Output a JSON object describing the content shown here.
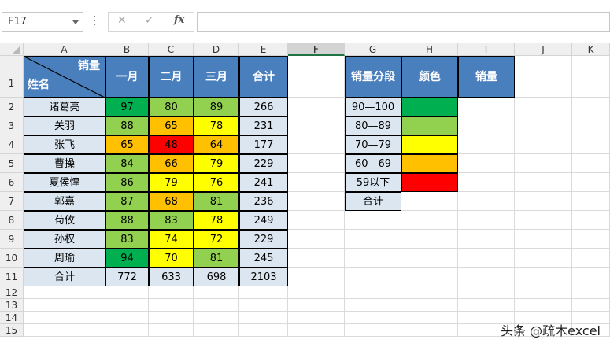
{
  "formula_bar": {
    "name_box": "F17",
    "cancel_icon": "✕",
    "enter_icon": "✓",
    "fx_label": "fx",
    "formula": ""
  },
  "columns": [
    "A",
    "B",
    "C",
    "D",
    "E",
    "F",
    "G",
    "H",
    "I",
    "J",
    "K"
  ],
  "selected_column": "F",
  "rows": [
    "1",
    "2",
    "3",
    "4",
    "5",
    "6",
    "7",
    "8",
    "9",
    "10",
    "11",
    "12",
    "13",
    "14",
    "15"
  ],
  "table": {
    "header_top_right": "销量",
    "header_bottom_left": "姓名",
    "month_headers": [
      "一月",
      "二月",
      "三月",
      "合计"
    ],
    "data": [
      {
        "name": "诸葛亮",
        "b": "97",
        "c": "80",
        "d": "89",
        "e": "266"
      },
      {
        "name": "关羽",
        "b": "88",
        "c": "65",
        "d": "78",
        "e": "231"
      },
      {
        "name": "张飞",
        "b": "65",
        "c": "48",
        "d": "64",
        "e": "177"
      },
      {
        "name": "曹操",
        "b": "84",
        "c": "66",
        "d": "79",
        "e": "229"
      },
      {
        "name": "夏侯惇",
        "b": "86",
        "c": "79",
        "d": "76",
        "e": "241"
      },
      {
        "name": "郭嘉",
        "b": "87",
        "c": "68",
        "d": "81",
        "e": "236"
      },
      {
        "name": "荀攸",
        "b": "88",
        "c": "83",
        "d": "78",
        "e": "249"
      },
      {
        "name": "孙权",
        "b": "83",
        "c": "74",
        "d": "72",
        "e": "229"
      },
      {
        "name": "周瑜",
        "b": "94",
        "c": "70",
        "d": "81",
        "e": "245"
      }
    ],
    "total": {
      "name": "合计",
      "b": "772",
      "c": "633",
      "d": "698",
      "e": "2103"
    }
  },
  "legend_table": {
    "headers": [
      "销量分段",
      "颜色",
      "销量"
    ],
    "rows": [
      "90—100",
      "80—89",
      "70—79",
      "60—69",
      "59以下",
      "合计"
    ]
  },
  "colors": {
    "dark_green": "#00b050",
    "light_green": "#92d050",
    "yellow": "#ffff00",
    "orange": "#ffc000",
    "red": "#ff0000",
    "header_blue": "#4a7fbd",
    "light_blue": "#dce6f1"
  },
  "watermark": "头条 @疏木excel"
}
